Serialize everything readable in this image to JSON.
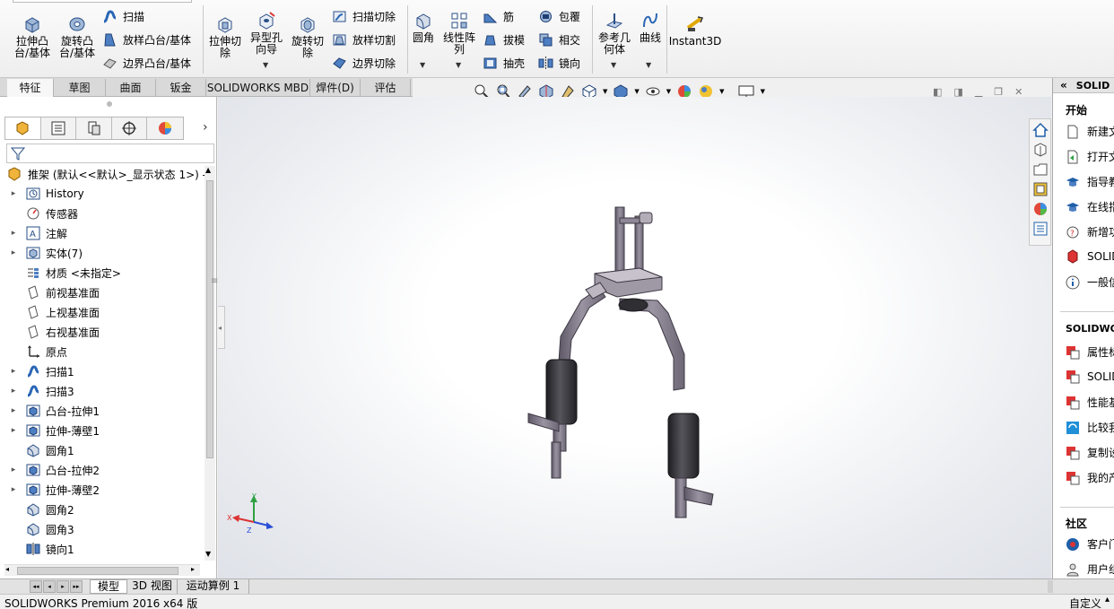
{
  "ribbon": {
    "extrude_boss": "拉伸凸\n台/基体",
    "revolve_boss": "旋转凸\n台/基体",
    "sweep": "扫描",
    "loft_boss": "放样凸台/基体",
    "boundary_boss": "边界凸台/基体",
    "extrude_cut": "拉伸切\n除",
    "hole_wizard": "异型孔\n向导",
    "revolve_cut": "旋转切\n除",
    "swept_cut": "扫描切除",
    "lofted_cut": "放样切割",
    "boundary_cut": "边界切除",
    "fillet": "圆角",
    "linear_pattern": "线性阵\n列",
    "rib": "筋",
    "draft": "拔模",
    "shell": "抽壳",
    "wrap": "包覆",
    "intersect": "相交",
    "mirror": "镜向",
    "ref_geometry": "参考几\n何体",
    "curves": "曲线",
    "instant3d": "Instant3D"
  },
  "tabs": [
    "特征",
    "草图",
    "曲面",
    "钣金",
    "SOLIDWORKS MBD",
    "焊件(D)",
    "评估"
  ],
  "tree": {
    "root": "推架 (默认<<默认>_显示状态 1>) -",
    "items": [
      {
        "label": "History",
        "icon": "history-icon",
        "expand": true
      },
      {
        "label": "传感器",
        "icon": "sensor-icon",
        "expand": false
      },
      {
        "label": "注解",
        "icon": "annotation-icon",
        "expand": true
      },
      {
        "label": "实体(7)",
        "icon": "solid-bodies-icon",
        "expand": true
      },
      {
        "label": "材质 <未指定>",
        "icon": "material-icon",
        "expand": false
      },
      {
        "label": "前视基准面",
        "icon": "plane-icon",
        "expand": false
      },
      {
        "label": "上视基准面",
        "icon": "plane-icon",
        "expand": false
      },
      {
        "label": "右视基准面",
        "icon": "plane-icon",
        "expand": false
      },
      {
        "label": "原点",
        "icon": "origin-icon",
        "expand": false
      },
      {
        "label": "扫描1",
        "icon": "sweep-icon",
        "expand": true
      },
      {
        "label": "扫描3",
        "icon": "sweep-icon",
        "expand": true
      },
      {
        "label": "凸台-拉伸1",
        "icon": "extrude-icon",
        "expand": true
      },
      {
        "label": "拉伸-薄壁1",
        "icon": "extrude-icon",
        "expand": true
      },
      {
        "label": "圆角1",
        "icon": "fillet-icon",
        "expand": false
      },
      {
        "label": "凸台-拉伸2",
        "icon": "extrude-icon",
        "expand": true
      },
      {
        "label": "拉伸-薄壁2",
        "icon": "extrude-icon",
        "expand": true
      },
      {
        "label": "圆角2",
        "icon": "fillet-icon",
        "expand": false
      },
      {
        "label": "圆角3",
        "icon": "fillet-icon",
        "expand": false
      },
      {
        "label": "镜向1",
        "icon": "mirror-icon",
        "expand": false
      }
    ]
  },
  "triad": {
    "x": "X",
    "y": "Y",
    "z": "Z"
  },
  "task_pane": {
    "header": "SOLID",
    "start_title": "开始",
    "start_items": [
      "新建文",
      "打开文",
      "指导教",
      "在线指",
      "新增功",
      "SOLID",
      "一般信"
    ],
    "solidworks_title": "SOLIDWOR",
    "solidworks_items": [
      "属性标",
      "SOLID",
      "性能基",
      "比较我",
      "复制设",
      "我的产"
    ],
    "community_title": "社区",
    "community_items": [
      "客户门",
      "用户组"
    ],
    "customize": "自定义"
  },
  "bottom_tabs": [
    "模型",
    "3D 视图",
    "运动算例 1"
  ],
  "status": "SOLIDWORKS Premium 2016 x64 版",
  "colors": {
    "accent": "#1f5fa8",
    "model_body": "#7d7585",
    "model_sleeve": "#2f2f33"
  }
}
